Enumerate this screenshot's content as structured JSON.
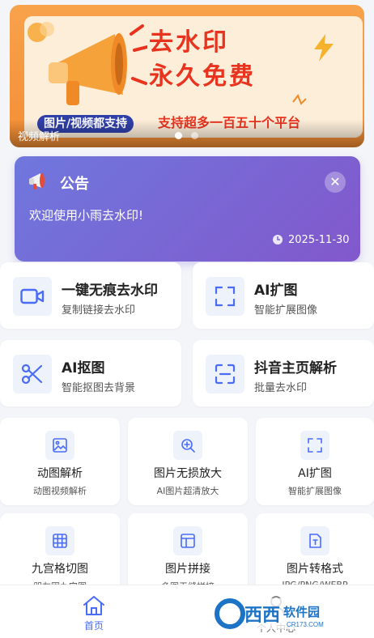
{
  "banner": {
    "headline_line1": "去水印",
    "headline_line2": "永久免费",
    "pill": "图片/视频都支持",
    "support": "支持超多一百五十个平台",
    "caption": "视频解析",
    "active_indicator": 1,
    "indicator_count": 2
  },
  "notice": {
    "title": "公告",
    "icon": "megaphone-icon",
    "close_symbol": "✕",
    "body": "欢迎使用小雨去水印!",
    "date": "2025-11-30"
  },
  "features_large": [
    {
      "title": "一键无痕去水印",
      "subtitle": "复制链接去水印",
      "icon": "video-camera-icon"
    },
    {
      "title": "AI扩图",
      "subtitle": "智能扩展图像",
      "icon": "expand-corners-icon"
    },
    {
      "title": "AI抠图",
      "subtitle": "智能抠图去背景",
      "icon": "scissors-icon"
    },
    {
      "title": "抖音主页解析",
      "subtitle": "批量去水印",
      "icon": "scan-frame-icon"
    }
  ],
  "features_small": [
    {
      "title": "动图解析",
      "subtitle": "动图视频解析",
      "icon": "image-icon"
    },
    {
      "title": "图片无损放大",
      "subtitle": "AI图片超清放大",
      "icon": "zoom-in-icon"
    },
    {
      "title": "AI扩图",
      "subtitle": "智能扩展图像",
      "icon": "expand-corners-icon"
    },
    {
      "title": "九宫格切图",
      "subtitle": "朋友圈九宫图",
      "icon": "grid-icon"
    },
    {
      "title": "图片拼接",
      "subtitle": "多图无缝拼接",
      "icon": "layout-icon"
    },
    {
      "title": "图片转格式",
      "subtitle": "JPG/PNG/WEBP",
      "icon": "file-convert-icon"
    }
  ],
  "nav": {
    "home_label": "首页",
    "mine_label": "个人中心"
  },
  "watermark": {
    "text": "西西软件园",
    "sub": "CR173.COM"
  },
  "colors": {
    "accent": "#4a6cf7",
    "banner_orange": "#f48e35",
    "headline_red": "#e8331f",
    "notice_gradient_start": "#6f77dd",
    "notice_gradient_end": "#8258cc"
  }
}
